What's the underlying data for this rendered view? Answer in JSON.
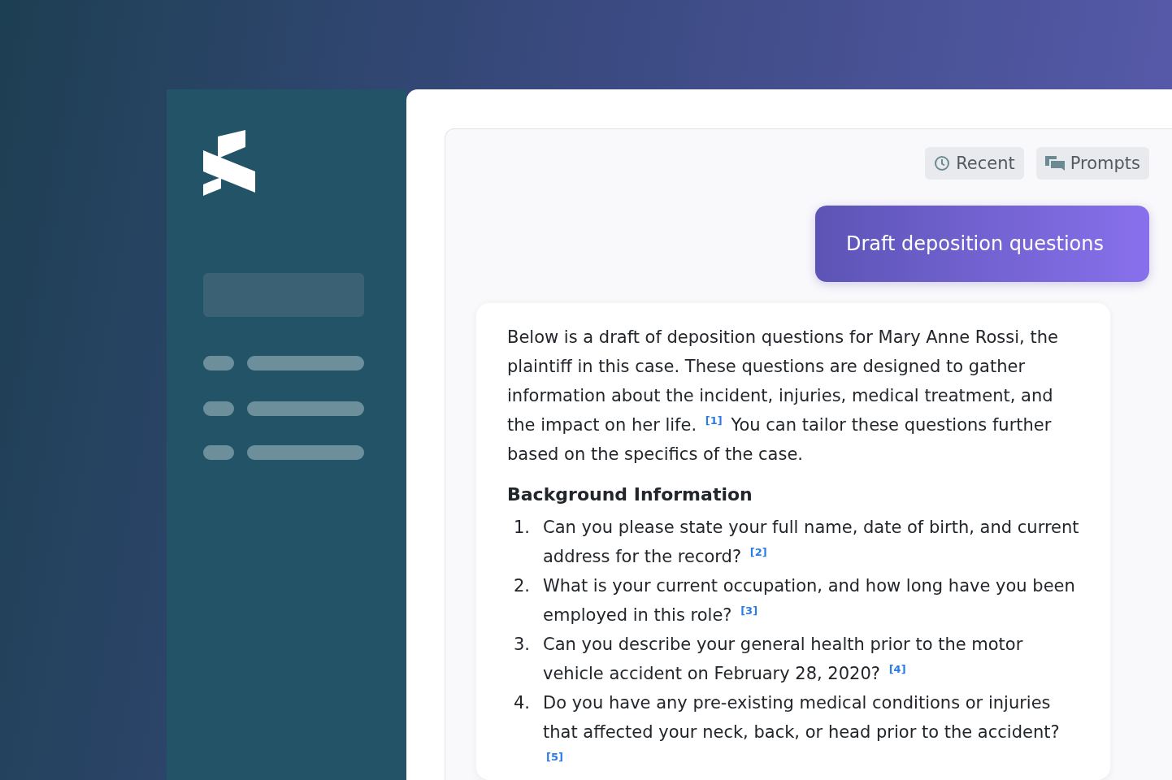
{
  "toolbar": [
    {
      "kind": "clock",
      "label": "Recent"
    },
    {
      "kind": "chat",
      "label": "Prompts"
    }
  ],
  "prompt": "Draft deposition questions",
  "answer": {
    "intro": {
      "before": "Below is a draft of deposition questions for Mary Anne Rossi, the plaintiff in this case. These questions are designed to gather information about the incident, injuries, medical treatment, and the impact on her life.",
      "citation": "[1]",
      "after": "You can tailor these questions further based on the specifics of the case."
    },
    "heading": "Background Information",
    "questions": [
      {
        "number": "1.",
        "text": "Can you please state your full name, date of birth, and current address for the record?",
        "citation": "[2]"
      },
      {
        "number": "2.",
        "text": "What is your current occupation, and how long have you been employed in this role?",
        "citation": "[3]"
      },
      {
        "number": "3.",
        "text": "Can you describe your general health prior to the motor vehicle accident on February 28, 2020?",
        "citation": "[4]"
      },
      {
        "number": "4.",
        "text": "Do you have any pre-existing medical conditions or injuries that affected your neck, back, or head prior to the accident?",
        "citation": "[5]"
      }
    ]
  }
}
